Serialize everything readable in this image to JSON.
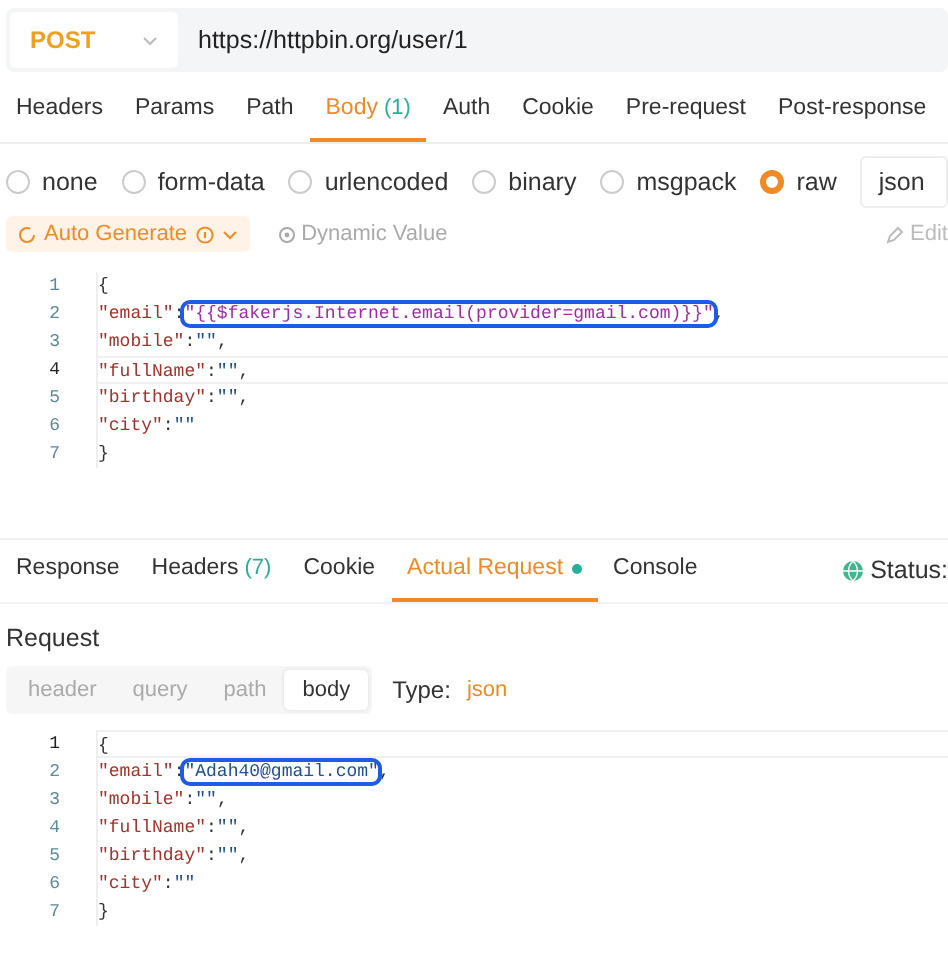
{
  "request": {
    "method": "POST",
    "url": "https://httpbin.org/user/1"
  },
  "tabs": [
    {
      "label": "Headers",
      "selected": false
    },
    {
      "label": "Params",
      "selected": false
    },
    {
      "label": "Path",
      "selected": false
    },
    {
      "label": "Body",
      "count": "(1)",
      "selected": true
    },
    {
      "label": "Auth",
      "selected": false
    },
    {
      "label": "Cookie",
      "selected": false
    },
    {
      "label": "Pre-request",
      "selected": false
    },
    {
      "label": "Post-response",
      "selected": false
    }
  ],
  "body_types": [
    {
      "label": "none",
      "selected": false
    },
    {
      "label": "form-data",
      "selected": false
    },
    {
      "label": "urlencoded",
      "selected": false
    },
    {
      "label": "binary",
      "selected": false
    },
    {
      "label": "msgpack",
      "selected": false
    },
    {
      "label": "raw",
      "selected": true
    }
  ],
  "format": "json",
  "toolbar": {
    "auto_generate": "Auto Generate",
    "dynamic_value": "Dynamic Value",
    "edit": "Edit"
  },
  "editor": [
    {
      "number": "1",
      "current": false,
      "tokens": [
        {
          "kind": "punct",
          "text": "{"
        }
      ]
    },
    {
      "number": "2",
      "current": false,
      "tokens": [
        {
          "kind": "key",
          "text": "\"email\""
        },
        {
          "kind": "punct",
          "text": ":"
        },
        {
          "kind": "template",
          "text": "\"{{$fakerjs.Internet.email(provider=gmail.com)}}\"",
          "boxed": true
        },
        {
          "kind": "punct",
          "text": ","
        }
      ]
    },
    {
      "number": "3",
      "current": false,
      "tokens": [
        {
          "kind": "key",
          "text": "\"mobile\""
        },
        {
          "kind": "punct",
          "text": ":"
        },
        {
          "kind": "string",
          "text": "\"\""
        },
        {
          "kind": "punct",
          "text": ","
        }
      ]
    },
    {
      "number": "4",
      "current": true,
      "tokens": [
        {
          "kind": "key",
          "text": "\"fullName\""
        },
        {
          "kind": "punct",
          "text": ":"
        },
        {
          "kind": "string",
          "text": "\"\""
        },
        {
          "kind": "punct",
          "text": ","
        }
      ]
    },
    {
      "number": "5",
      "current": false,
      "tokens": [
        {
          "kind": "key",
          "text": "\"birthday\""
        },
        {
          "kind": "punct",
          "text": ":"
        },
        {
          "kind": "string",
          "text": "\"\""
        },
        {
          "kind": "punct",
          "text": ","
        }
      ]
    },
    {
      "number": "6",
      "current": false,
      "tokens": [
        {
          "kind": "key",
          "text": "\"city\""
        },
        {
          "kind": "punct",
          "text": ":"
        },
        {
          "kind": "string",
          "text": "\"\""
        }
      ]
    },
    {
      "number": "7",
      "current": false,
      "tokens": [
        {
          "kind": "punct",
          "text": "}"
        }
      ]
    }
  ],
  "response_tabs": [
    {
      "label": "Response",
      "selected": false
    },
    {
      "label": "Headers",
      "count": "(7)",
      "selected": false
    },
    {
      "label": "Cookie",
      "selected": false
    },
    {
      "label": "Actual Request",
      "dot": true,
      "selected": true
    },
    {
      "label": "Console",
      "selected": false
    }
  ],
  "status": "Status:",
  "request_section": {
    "title": "Request",
    "parts": [
      {
        "label": "header",
        "selected": false
      },
      {
        "label": "query",
        "selected": false
      },
      {
        "label": "path",
        "selected": false
      },
      {
        "label": "body",
        "selected": true
      }
    ],
    "type_label": "Type:",
    "type": "json"
  },
  "actual_editor": [
    {
      "number": "1",
      "current": true,
      "tokens": [
        {
          "kind": "punct",
          "text": "{"
        }
      ]
    },
    {
      "number": "2",
      "current": false,
      "tokens": [
        {
          "kind": "key",
          "text": "\"email\""
        },
        {
          "kind": "punct",
          "text": ":"
        },
        {
          "kind": "string",
          "text": "\"Adah40@gmail.com\"",
          "boxed": true
        },
        {
          "kind": "punct",
          "text": ","
        }
      ]
    },
    {
      "number": "3",
      "current": false,
      "tokens": [
        {
          "kind": "key",
          "text": "\"mobile\""
        },
        {
          "kind": "punct",
          "text": ":"
        },
        {
          "kind": "string",
          "text": "\"\""
        },
        {
          "kind": "punct",
          "text": ","
        }
      ]
    },
    {
      "number": "4",
      "current": false,
      "tokens": [
        {
          "kind": "key",
          "text": "\"fullName\""
        },
        {
          "kind": "punct",
          "text": ":"
        },
        {
          "kind": "string",
          "text": "\"\""
        },
        {
          "kind": "punct",
          "text": ","
        }
      ]
    },
    {
      "number": "5",
      "current": false,
      "tokens": [
        {
          "kind": "key",
          "text": "\"birthday\""
        },
        {
          "kind": "punct",
          "text": ":"
        },
        {
          "kind": "string",
          "text": "\"\""
        },
        {
          "kind": "punct",
          "text": ","
        }
      ]
    },
    {
      "number": "6",
      "current": false,
      "tokens": [
        {
          "kind": "key",
          "text": "\"city\""
        },
        {
          "kind": "punct",
          "text": ":"
        },
        {
          "kind": "string",
          "text": "\"\""
        }
      ]
    },
    {
      "number": "7",
      "current": false,
      "tokens": [
        {
          "kind": "punct",
          "text": "}"
        }
      ]
    }
  ]
}
